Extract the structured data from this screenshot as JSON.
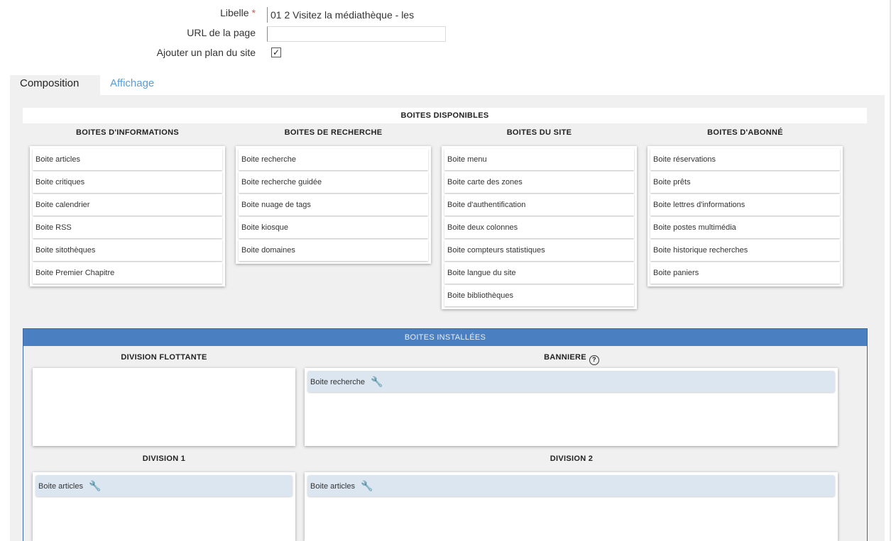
{
  "form": {
    "libelle_label": "Libelle",
    "libelle_required": "*",
    "libelle_value": "01 2 Visitez la médiathèque - les",
    "url_label": "URL de la page",
    "url_value": "",
    "sitemap_label": "Ajouter un plan du site",
    "sitemap_checked": true,
    "checkbox_glyph": "✓"
  },
  "tabs": [
    {
      "label": "Composition",
      "active": true
    },
    {
      "label": "Affichage",
      "active": false
    }
  ],
  "available": {
    "title": "BOITES DISPONIBLES",
    "columns": [
      {
        "title": "BOITES D'INFORMATIONS",
        "items": [
          "Boite articles",
          "Boite critiques",
          "Boite calendrier",
          "Boite RSS",
          "Boite sitothèques",
          "Boite Premier Chapitre"
        ]
      },
      {
        "title": "BOITES DE RECHERCHE",
        "items": [
          "Boite recherche",
          "Boite recherche guidée",
          "Boite nuage de tags",
          "Boite kiosque",
          "Boite domaines"
        ]
      },
      {
        "title": "BOITES DU SITE",
        "items": [
          "Boite menu",
          "Boite carte des zones",
          "Boite d'authentification",
          "Boite deux colonnes",
          "Boite compteurs statistiques",
          "Boite langue du site",
          "Boite bibliothèques"
        ]
      },
      {
        "title": "BOITES D'ABONNÉ",
        "items": [
          "Boite réservations",
          "Boite prêts",
          "Boite lettres d'informations",
          "Boite postes multimédia",
          "Boite historique recherches",
          "Boite paniers"
        ]
      }
    ]
  },
  "installed": {
    "title": "BOITES INSTALLÉES",
    "help_glyph": "?",
    "wrench_glyph": "🔧",
    "zones": {
      "floating": {
        "title": "DIVISION FLOTTANTE",
        "items": []
      },
      "banner": {
        "title": "BANNIERE",
        "items": [
          "Boite recherche"
        ]
      },
      "division1": {
        "title": "DIVISION 1",
        "items": [
          "Boite articles"
        ]
      },
      "division2": {
        "title": "DIVISION 2",
        "items": [
          "Boite articles"
        ]
      }
    }
  },
  "icons": {
    "help": "help-circle-icon",
    "wrench": "wrench-icon",
    "checkbox": "checkbox-checked-icon"
  },
  "colors": {
    "installed_header": "#4a7fc1",
    "tab_link": "#5b9bd5",
    "placed_box": "#dce6f1",
    "required": "#d9534f"
  }
}
